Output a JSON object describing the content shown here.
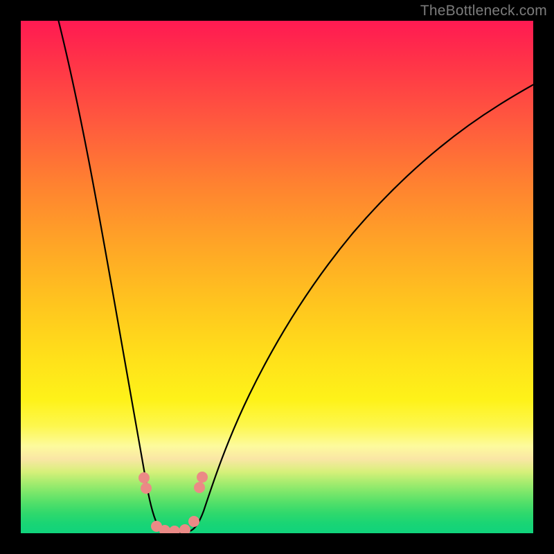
{
  "watermark": "TheBottleneck.com",
  "colors": {
    "background": "#000000",
    "curve_stroke": "#000000",
    "marker_fill": "#eb8a86",
    "gradient_top": "#ff1a52",
    "gradient_bottom": "#10d37c"
  },
  "chart_data": {
    "type": "line",
    "title": "",
    "xlabel": "",
    "ylabel": "",
    "xlim": [
      0,
      100
    ],
    "ylim": [
      0,
      100
    ],
    "note": "Axes are unitless (no ticks drawn). Vertical axis represents a bottleneck/mismatch metric where 0=green (good) and 100=red (bad). A V-shaped curve dips to ~0 around x≈27–33 and rises toward red elsewhere.",
    "series": [
      {
        "name": "bottleneck-curve",
        "x": [
          5,
          10,
          15,
          18,
          20,
          22,
          24,
          25,
          26,
          28,
          30,
          32,
          34,
          35,
          36,
          40,
          45,
          50,
          55,
          60,
          65,
          70,
          75,
          80,
          85,
          90,
          95,
          100
        ],
        "y": [
          100,
          80,
          55,
          38,
          27,
          17,
          8,
          4,
          1,
          0,
          0,
          0,
          1,
          3,
          6,
          18,
          30,
          40,
          48,
          55,
          61,
          66,
          70,
          73,
          76,
          78,
          80,
          81
        ]
      }
    ],
    "markers": {
      "name": "highlighted-points",
      "x": [
        23.0,
        23.5,
        25.8,
        27.5,
        29.5,
        31.5,
        33.3,
        34.0,
        34.5
      ],
      "y": [
        11.0,
        9.0,
        1.0,
        0.0,
        0.0,
        0.2,
        2.0,
        8.5,
        10.5
      ]
    }
  }
}
